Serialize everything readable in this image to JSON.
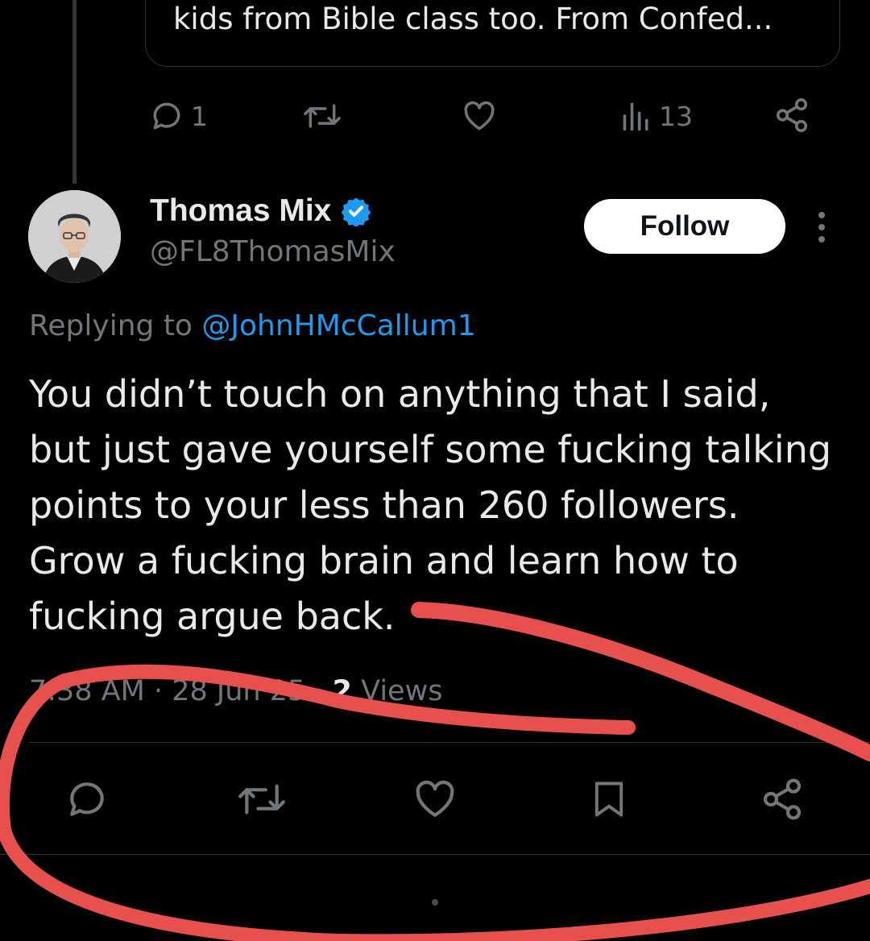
{
  "previous_tweet": {
    "quote_text": "kids from Bible class too. From Confed...",
    "actions": {
      "reply_count": "1",
      "retweet_count": "",
      "like_count": "",
      "views_count": "13"
    }
  },
  "tweet": {
    "author_name": "Thomas Mix",
    "verified": true,
    "handle": "@FL8ThomasMix",
    "follow_label": "Follow",
    "replying_prefix": "Replying to ",
    "replying_to": "@JohnHMcCallum1",
    "body": "You didn’t touch on anything that I said, but just gave yourself some fucking talking points to your less than 260 followers. Grow a fucking brain and learn how to fucking argue back.",
    "time": "7:38 AM",
    "separator": " · ",
    "date": "28 Jun 25",
    "views_count": "2",
    "views_label": " Views"
  },
  "colors": {
    "background": "#000000",
    "text": "#e7e9ea",
    "secondary": "#71767b",
    "link": "#1d9bf0",
    "verified": "#1d9bf0",
    "annotation": "#e8504e"
  },
  "icons": [
    "reply-icon",
    "retweet-icon",
    "like-icon",
    "views-icon",
    "share-icon",
    "bookmark-icon",
    "verified-badge-icon",
    "more-icon"
  ]
}
